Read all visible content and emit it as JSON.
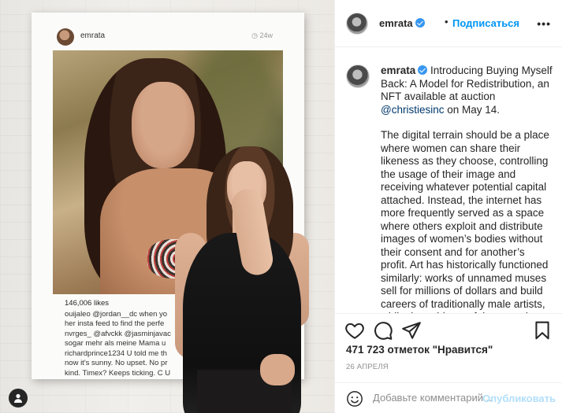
{
  "media": {
    "print": {
      "username": "emrata",
      "time": "24w",
      "likes": "146,006 likes",
      "comments": [
        "ouijaleo @jordan__dc when yo",
        "her insta feed to find the perfe",
        "nvrges_ @afvckk @jasminjavac",
        "sogar mehr als meine Mama u",
        "richardprince1234 U told me th",
        "now it's sunny. No upset. No pr",
        "kind. Timex? Keeps ticking. C U"
      ]
    }
  },
  "header": {
    "username": "emrata",
    "dot": "•",
    "follow_label": "Подписаться",
    "more_label": "•••"
  },
  "caption": {
    "username": "emrata",
    "intro": "Introducing Buying Myself Back: A Model for Redistribution, an NFT available at auction",
    "mention": "@christiesinc",
    "intro_end": "on May 14.",
    "body": "The digital terrain should be a place where women can share their likeness as they choose, controlling the usage of their image and receiving whatever potential capital attached. Instead, the internet has more frequently served as a space where others exploit and distribute images of women’s bodies without their consent and for another’s profit. Art has historically functioned similarly: works of unnamed muses sell for millions of dollars and build careers of traditionally male artists, while the subjects of these works receive"
  },
  "actions": {
    "like_icon": "heart-icon",
    "comment_icon": "comment-icon",
    "share_icon": "paper-plane-icon",
    "save_icon": "bookmark-icon",
    "likes_count": "471 723 отметок \"Нравится\"",
    "date": "26 АПРЕЛЯ"
  },
  "add_comment": {
    "placeholder": "Добавьте комментарий...",
    "publish_label": "Опубликовать"
  },
  "colors": {
    "accent": "#0095f6",
    "verified": "#3897f0",
    "publish_disabled": "#b2dffc"
  }
}
